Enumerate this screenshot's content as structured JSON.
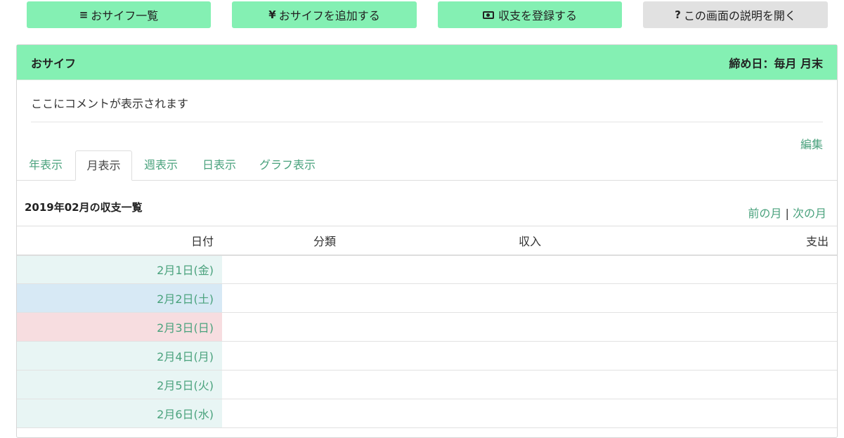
{
  "toolbar": {
    "list_label": "おサイフ一覧",
    "add_label": "おサイフを追加する",
    "register_label": "収支を登録する",
    "help_label": "この画面の説明を開く",
    "list_icon": "≡",
    "add_icon": "¥",
    "help_icon": "?"
  },
  "panel": {
    "title": "おサイフ",
    "closing_day": "締め日：毎月 月末",
    "comment": "ここにコメントが表示されます",
    "edit_label": "編集"
  },
  "tabs": [
    {
      "label": "年表示"
    },
    {
      "label": "月表示"
    },
    {
      "label": "週表示"
    },
    {
      "label": "日表示"
    },
    {
      "label": "グラフ表示"
    }
  ],
  "list": {
    "title": "2019年02月の収支一覧",
    "prev_label": "前の月",
    "separator": "|",
    "next_label": "次の月"
  },
  "table": {
    "headers": {
      "date": "日付",
      "category": "分類",
      "income": "収入",
      "expense": "支出"
    },
    "rows": [
      {
        "date": "2月1日(金)"
      },
      {
        "date": "2月2日(土)"
      },
      {
        "date": "2月3日(日)"
      },
      {
        "date": "2月4日(月)"
      },
      {
        "date": "2月5日(火)"
      },
      {
        "date": "2月6日(水)"
      }
    ]
  },
  "colors": {
    "accent": "#84f0b3",
    "link": "#4aa27d",
    "weekday_bg": "#e8f5f4",
    "saturday_bg": "#d7e9f5",
    "sunday_bg": "#f7dde0"
  }
}
